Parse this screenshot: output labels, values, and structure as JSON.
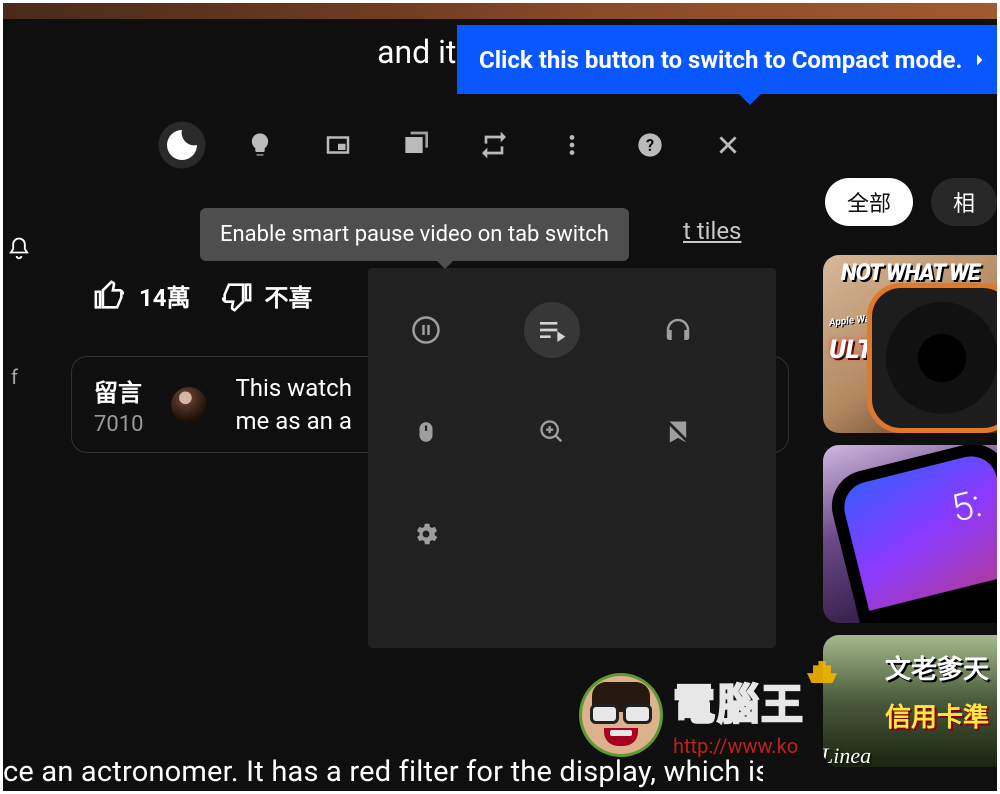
{
  "caption_top": "and it's called the",
  "callout": {
    "text": "Click this button to switch to Compact mode."
  },
  "toolbar": {
    "dark_mode": "dark-mode",
    "light": "light",
    "pip": "picture-in-picture",
    "tabs": "tabs",
    "loop": "loop",
    "more": "more",
    "help": "help",
    "close": "close"
  },
  "tooltip_pause": "Enable smart pause video on tab switch",
  "tiles_link": "t tiles",
  "likes": {
    "count": "14萬"
  },
  "dislike_label": "不喜",
  "comments": {
    "title": "留言",
    "count": "7010",
    "featured_line1": "This watch",
    "featured_line2": "me as an a"
  },
  "panel": {
    "pause": "pause",
    "playlist": "playlist-play",
    "headphones": "headphones",
    "mouse": "mouse",
    "zoom": "zoom-in",
    "bookmark_off": "bookmark-off",
    "settings": "settings"
  },
  "chips": {
    "all": "全部",
    "related": "相"
  },
  "thumbs": {
    "t1_caption": "NOT WHAT WE",
    "t1_aw": "Apple Watch",
    "t1_ultra": "ULTRA",
    "t2_time": "5:",
    "t3_line1": "文老爹天",
    "t3_line2": "信用卡準",
    "t3_logo": "Linea"
  },
  "watermark": {
    "cn": "電腦王",
    "url": "http://www.ko"
  },
  "caption_bottom": "ce an actronomer. It has a red filter for the display, which is"
}
